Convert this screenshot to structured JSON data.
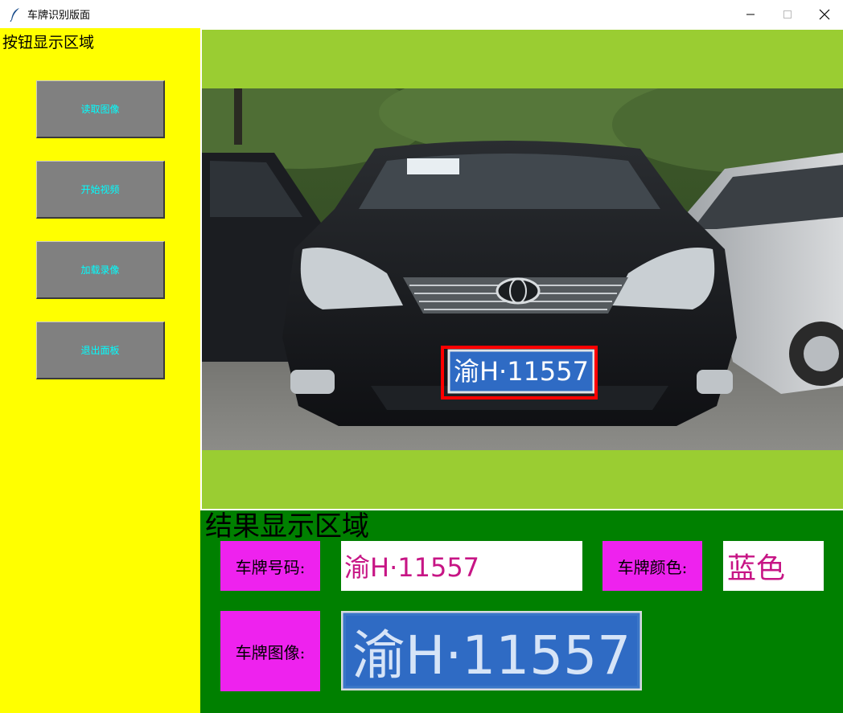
{
  "window": {
    "title": "车牌识别版面",
    "app_icon": "feather-icon",
    "controls": [
      "minimize-icon",
      "maximize-icon",
      "close-icon"
    ]
  },
  "left_panel": {
    "label": "按钮显示区域",
    "buttons": [
      {
        "label": "读取图像"
      },
      {
        "label": "开始视频"
      },
      {
        "label": "加载录像"
      },
      {
        "label": "退出面板"
      }
    ]
  },
  "image_panel": {
    "photo_plate_text": "渝H·11557"
  },
  "result_panel": {
    "title": "结果显示区域",
    "plate_number_label": "车牌号码:",
    "plate_number_value": "渝H·11557",
    "plate_color_label": "车牌颜色:",
    "plate_color_value": "蓝色",
    "plate_image_label": "车牌图像:",
    "plate_image_text": "渝H·11557"
  },
  "colors": {
    "left_panel_bg": "#ffff00",
    "button_bg": "#808080",
    "button_text": "#00ffff",
    "image_panel_bg": "#9acd32",
    "result_panel_bg": "#008000",
    "tag_bg": "#ee22ee",
    "value_text": "#c71585",
    "plate_blue": "#2f6bc4",
    "detect_box": "#ff0000"
  }
}
